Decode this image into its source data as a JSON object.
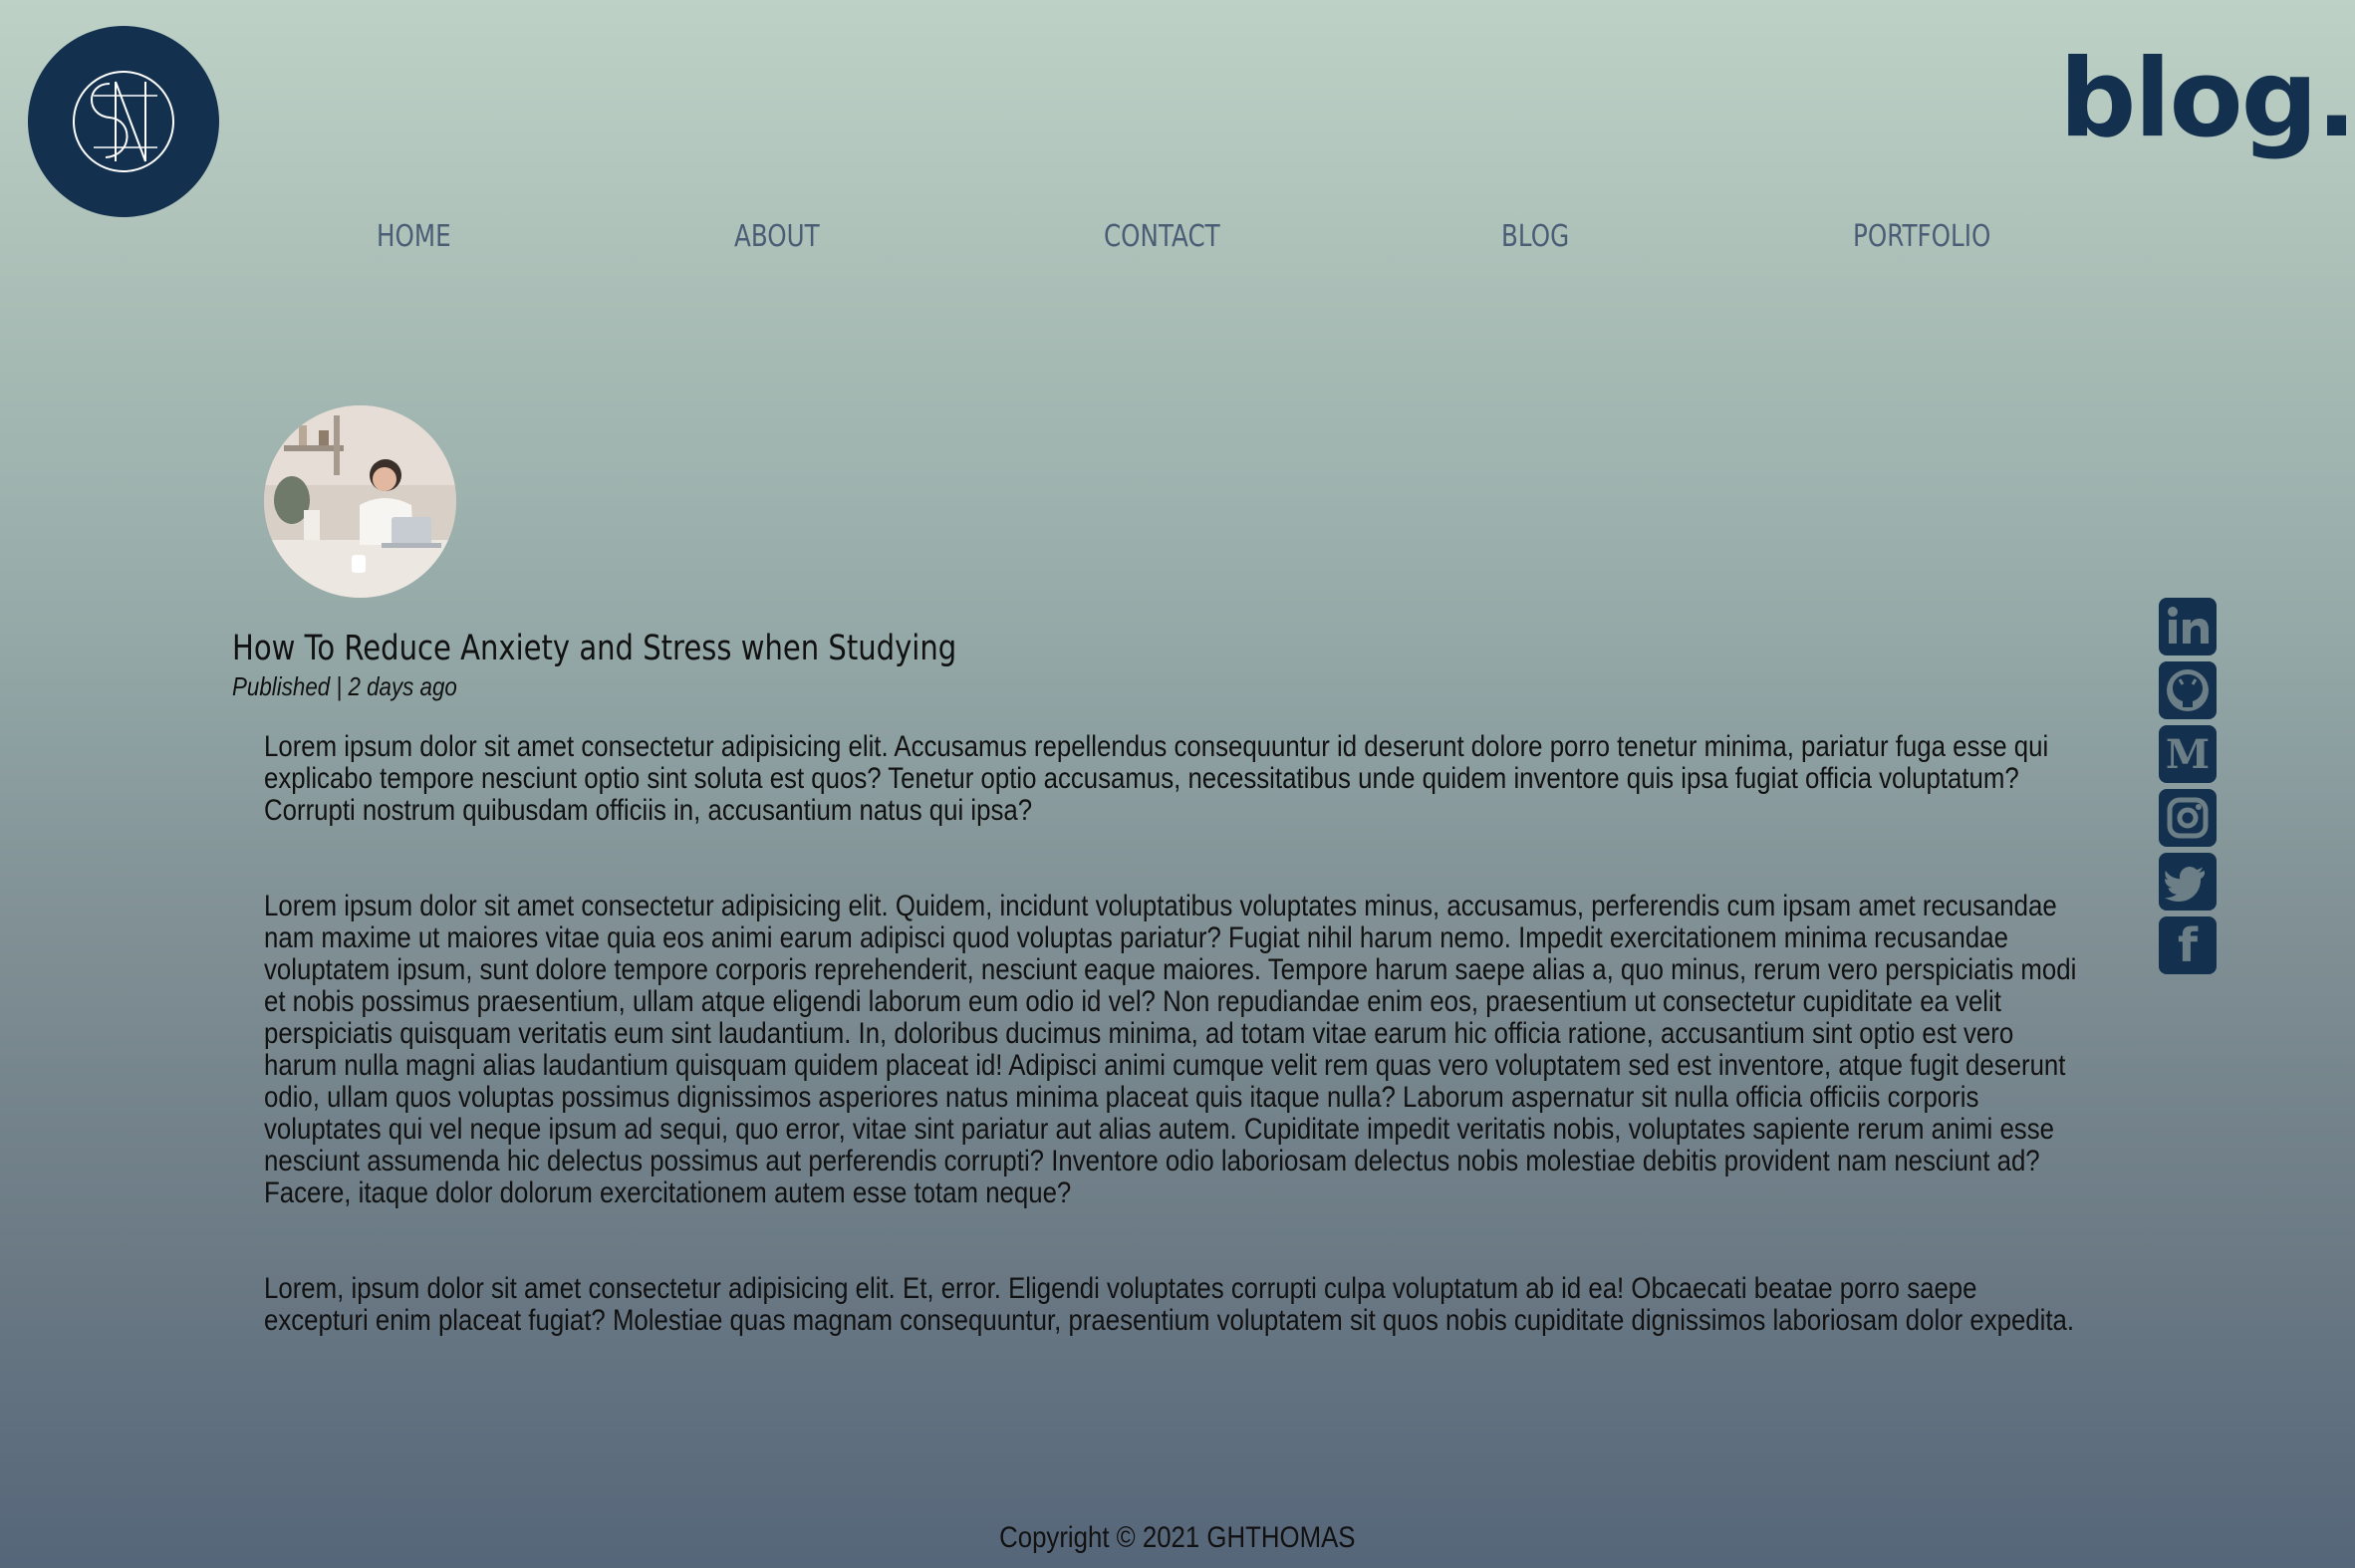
{
  "header": {
    "brand": "blog.",
    "logo_monogram": "SN"
  },
  "nav": {
    "items": [
      {
        "label": "HOME"
      },
      {
        "label": "ABOUT"
      },
      {
        "label": "CONTACT"
      },
      {
        "label": "BLOG"
      },
      {
        "label": "PORTFOLIO"
      }
    ]
  },
  "post": {
    "title": "How To Reduce Anxiety and Stress when Studying",
    "meta": "Published | 2 days ago",
    "paragraphs": [
      "Lorem ipsum dolor sit amet consectetur adipisicing elit. Accusamus repellendus consequuntur id deserunt dolore porro tenetur minima, pariatur fuga esse qui explicabo tempore nesciunt optio sint soluta est quos? Tenetur optio accusamus, necessitatibus unde quidem inventore quis ipsa fugiat officia voluptatum? Corrupti nostrum quibusdam officiis in, accusantium natus qui ipsa?",
      "Lorem ipsum dolor sit amet consectetur adipisicing elit. Quidem, incidunt voluptatibus voluptates minus, accusamus, perferendis cum ipsam amet recusandae nam maxime ut maiores vitae quia eos animi earum adipisci quod voluptas pariatur? Fugiat nihil harum nemo. Impedit exercitationem minima recusandae voluptatem ipsum, sunt dolore tempore corporis reprehenderit, nesciunt eaque maiores. Tempore harum saepe alias a, quo minus, rerum vero perspiciatis modi et nobis possimus praesentium, ullam atque eligendi laborum eum odio id vel? Non repudiandae enim eos, praesentium ut consectetur cupiditate ea velit perspiciatis quisquam veritatis eum sint laudantium. In, doloribus ducimus minima, ad totam vitae earum hic officia ratione, accusantium sint optio est vero harum nulla magni alias laudantium quisquam quidem placeat id! Adipisci animi cumque velit rem quas vero voluptatem sed est inventore, atque fugit deserunt odio, ullam quos voluptas possimus dignissimos asperiores natus minima placeat quis itaque nulla? Laborum aspernatur sit nulla officia officiis corporis voluptates qui vel neque ipsum ad sequi, quo error, vitae sint pariatur aut alias autem. Cupiditate impedit veritatis nobis, voluptates sapiente rerum animi esse nesciunt assumenda hic delectus possimus aut perferendis corrupti? Inventore odio laboriosam delectus nobis molestiae debitis provident nam nesciunt ad? Facere, itaque dolor dolorum exercitationem autem esse totam neque?",
      "Lorem, ipsum dolor sit amet consectetur adipisicing elit. Et, error. Eligendi voluptates corrupti culpa voluptatum ab id ea! Obcaecati beatae porro saepe excepturi enim placeat fugiat? Molestiae quas magnam consequuntur, praesentium voluptatem sit quos nobis cupiditate dignissimos laboriosam dolor expedita."
    ]
  },
  "social": {
    "icons": [
      {
        "name": "linkedin-icon",
        "glyph": "in"
      },
      {
        "name": "github-icon",
        "glyph": ""
      },
      {
        "name": "medium-icon",
        "glyph": "M"
      },
      {
        "name": "instagram-icon",
        "glyph": ""
      },
      {
        "name": "twitter-icon",
        "glyph": ""
      },
      {
        "name": "facebook-icon",
        "glyph": "f"
      }
    ]
  },
  "footer": {
    "copyright": "Copyright © 2021 GHTHOMAS"
  },
  "colors": {
    "navy": "#13304f",
    "nav_text": "#4a5d75",
    "gradient_top": "#bdd1c6",
    "gradient_bottom": "#56667a"
  }
}
